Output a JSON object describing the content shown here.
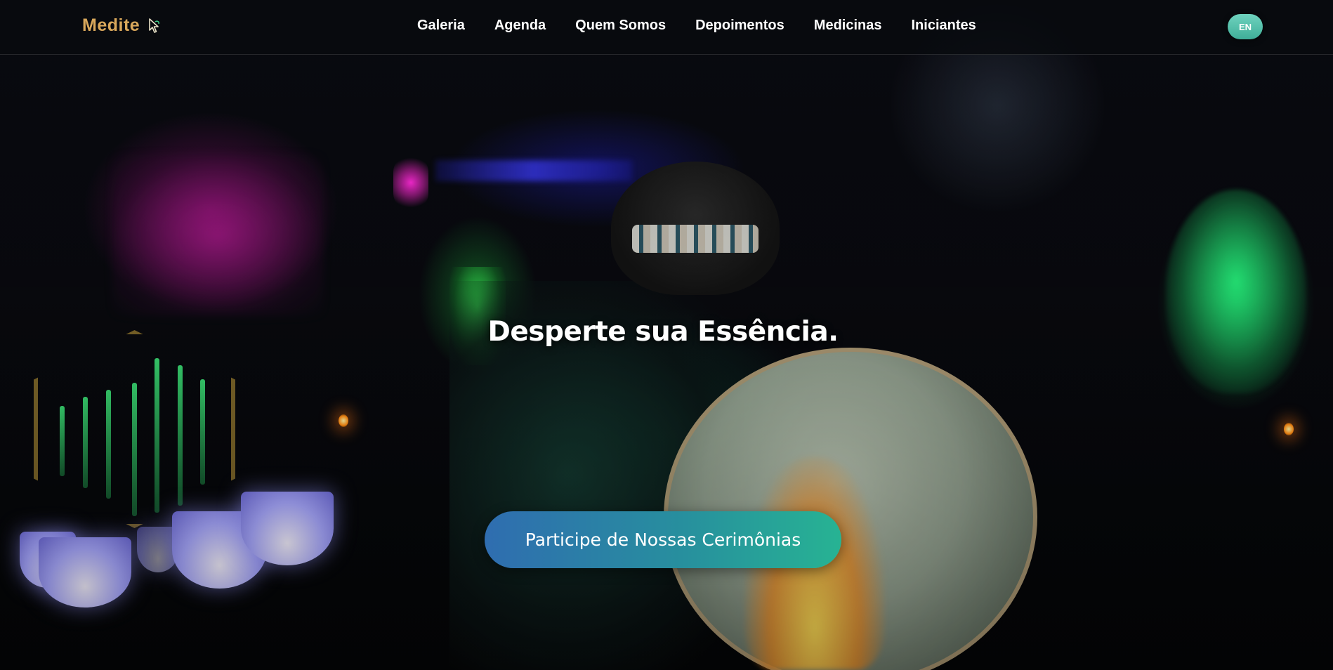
{
  "header": {
    "logo_text": "Medite",
    "logo_icon": "pointer-leaf-icon",
    "logo_color": "#d9a85b",
    "nav": [
      {
        "label": "Galeria"
      },
      {
        "label": "Agenda"
      },
      {
        "label": "Quem Somos"
      },
      {
        "label": "Depoimentos"
      },
      {
        "label": "Medicinas"
      },
      {
        "label": "Iniciantes"
      }
    ],
    "language_button": "EN",
    "language_button_color": "#4fbfa8"
  },
  "hero": {
    "title": "Desperte sua Essência.",
    "cta_label": "Participe de Nossas Cerimônias",
    "cta_gradient": [
      "#2f6db0",
      "#27b393"
    ],
    "background_image": "shaman-drum-ceremony-night-photo"
  }
}
